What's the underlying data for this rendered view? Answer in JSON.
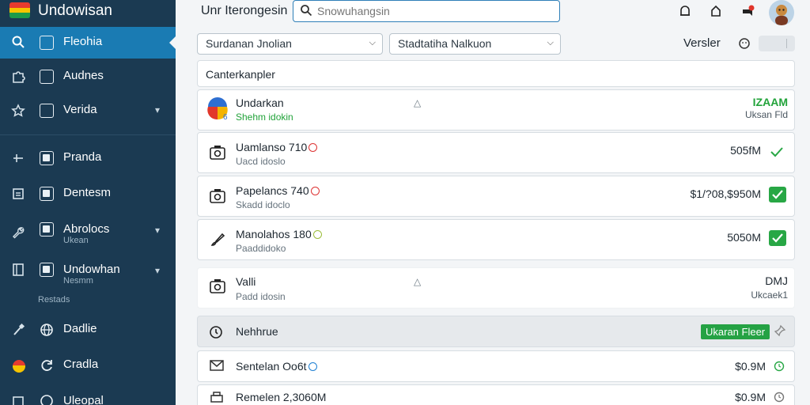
{
  "app": {
    "name": "Undowisan"
  },
  "topbar": {
    "title": "Unr Iterongesin",
    "search_placeholder": "Snowuhangsin"
  },
  "sidebar": {
    "items": [
      {
        "label": "Fleohia"
      },
      {
        "label": "Audnes"
      },
      {
        "label": "Verida"
      },
      {
        "label": "Pranda"
      },
      {
        "label": "Dentesm"
      },
      {
        "label": "Abrolocs",
        "sub": "Ukean"
      },
      {
        "label": "Undowhan",
        "sub": "Nesmm"
      },
      {
        "label": "Dadlie"
      },
      {
        "label": "Cradla"
      },
      {
        "label": "Uleopal"
      }
    ],
    "section_label": "Restads"
  },
  "filters": {
    "select1": "Surdanan Jnolian",
    "select2": "Stadtatiha Nalkuon",
    "versions_label": "Versler"
  },
  "category_field": {
    "value": "Canterkanpler"
  },
  "group1": {
    "title": "Undarkan",
    "sub": "Shehm idokin",
    "value": "IZAAM",
    "note": "Uksan Fld"
  },
  "rows": [
    {
      "title": "Uamlanso 710",
      "sub": "Uacd idoslo",
      "value": "505fM"
    },
    {
      "title": "Papelancs 740",
      "sub": "Skadd idoclo",
      "value": "$1/?08,$950M"
    },
    {
      "title": "Manolahos 180",
      "sub": "Paaddidoko",
      "value": "5050M"
    }
  ],
  "group2": {
    "title": "Valli",
    "sub": "Padd idosin",
    "value": "DMJ",
    "note": "Ukcaek1"
  },
  "section": {
    "title": "Nehhrue",
    "button": "Ukaran Fleer"
  },
  "bottom_rows": [
    {
      "title": "Sentelan Oo6t",
      "value": "$0.9M"
    },
    {
      "title": "Remelen 2,3060M",
      "value": "$0.9M"
    }
  ],
  "colors": {
    "sidebar_bg": "#1b3a52",
    "active_item": "#1a7bb3",
    "success": "#28a745",
    "search_border": "#2f7fb8"
  },
  "icons": {
    "search": "search-icon",
    "bell": "bell-icon",
    "notifications": "notification-icon",
    "alert": "alert-icon",
    "settings": "settings-icon",
    "check": "check-icon",
    "pin": "pin-icon"
  }
}
